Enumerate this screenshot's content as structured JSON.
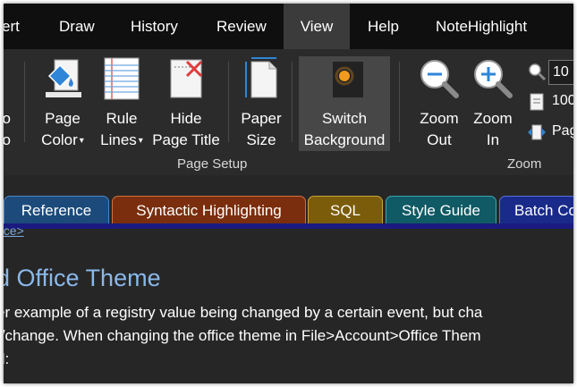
{
  "ribbon_tabs": [
    "ert",
    "Draw",
    "History",
    "Review",
    "View",
    "Help",
    "NoteHighlight"
  ],
  "ribbon": {
    "buttons": {
      "cut_left": "o\no",
      "page_color": "Page\nColor",
      "rule_lines": "Rule\nLines",
      "hide_page_title": "Hide\nPage Title",
      "paper_size": "Paper\nSize",
      "switch_background": "Switch\nBackground",
      "zoom_out": "Zoom\nOut",
      "zoom_in": "Zoom\nIn"
    },
    "zoom_box_value": "10",
    "zoom_100_label": "100",
    "page_width_label": "Pag",
    "groups": {
      "page_setup": "Page Setup",
      "zoom": "Zoom"
    }
  },
  "section_tabs": [
    {
      "label": "Reference",
      "color": "#1c4a7a",
      "border": "#4a86c8"
    },
    {
      "label": "Syntactic Highlighting",
      "color": "#7a2e0e",
      "border": "#d0703c"
    },
    {
      "label": "SQL",
      "color": "#7a5c0a",
      "border": "#c9a23a"
    },
    {
      "label": "Style Guide",
      "color": "#0f5a64",
      "border": "#3aa6b0"
    },
    {
      "label": "Batch Co",
      "color": "#1a2a8a",
      "border": "#5a6ed6"
    }
  ],
  "page": {
    "breadcrumb": "ace>",
    "title": "d Office Theme",
    "lines": [
      "er example of a registry value being changed by a certain event, but cha",
      ":/change. When changing the office theme in File>Account>Office Them",
      "d:"
    ]
  },
  "colors": {
    "accent_section_underline": "#1a1a80",
    "title_color": "#8ab8ea"
  }
}
